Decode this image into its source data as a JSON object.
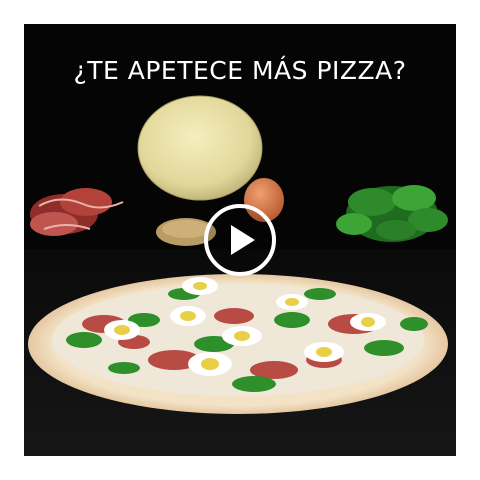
{
  "video": {
    "overlay_title": "¿TE APETECE MÁS PIZZA?",
    "play_icon": "play-icon"
  },
  "colors": {
    "background": "#050505",
    "overlay_text": "#ffffff",
    "play_ring": "#ffffff"
  }
}
